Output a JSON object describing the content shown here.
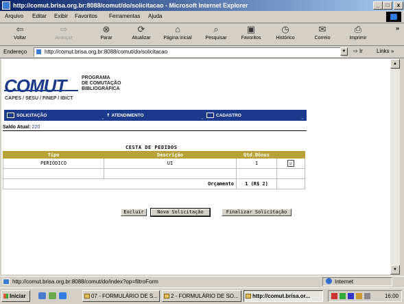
{
  "window": {
    "title": "http://comut.brisa.org.br:8088/comut/do/solicitacao - Microsoft Internet Explorer",
    "minimize": "_",
    "maximize": "□",
    "close": "x"
  },
  "menu": [
    "Arquivo",
    "Editar",
    "Exibir",
    "Favoritos",
    "Ferramentas",
    "Ajuda"
  ],
  "toolbar": {
    "back": "Voltar",
    "forward": "Avançar",
    "stop": "Parar",
    "refresh": "Atualizar",
    "home": "Página inicial",
    "search": "Pesquisar",
    "favorites": "Favoritos",
    "history": "Histórico",
    "mail": "Correio",
    "print": "Imprimir",
    "more": "»"
  },
  "address": {
    "label": "Endereço",
    "url": "http://comut.brisa.org.br:8088/comut/do/solicitacao",
    "go": "Ir",
    "links": "Links »"
  },
  "logo": {
    "comut": "COMUT",
    "line1": "PROGRAMA",
    "line2": "DE COMUTAÇÃO",
    "line3": "BIBLIOGRÁFICA",
    "caption": "CAPES / SESU / FINEP / IBICT"
  },
  "nav": {
    "solicitacao": "SOLICITAÇÃO",
    "atendimento": "ATENDIMENTO",
    "cadastro": "CADASTRO"
  },
  "saldo": {
    "label": "Saldo Atual:",
    "value": "220"
  },
  "cesta": {
    "title": "CESTA DE PEDIDOS",
    "headers": {
      "tipo": "Tipo",
      "descricao": "Descrição",
      "qtd": "Qtd.Bônus"
    },
    "row1": {
      "tipo": "PERIÓDICO",
      "descricao": "UI",
      "qtd": "1",
      "checked": "☑"
    },
    "orcamento_label": "Orçamento",
    "orcamento_value": "1 (R$ 2)"
  },
  "buttons": {
    "excluir": "Excluir",
    "nova": "Nova Solicitação",
    "finalizar": "Finalizar Solicitação"
  },
  "status": {
    "text": "http://comut.brisa.org.br:8088/comut/do/index?op=filtroForm",
    "zone": "Internet"
  },
  "taskbar": {
    "start": "Iniciar",
    "task1": "07 - FORMULÁRIO DE S...",
    "task2": "2 - FORMULÁRIO DE SO...",
    "task3": "http://comut.brisa.or...",
    "clock": "16:00"
  }
}
